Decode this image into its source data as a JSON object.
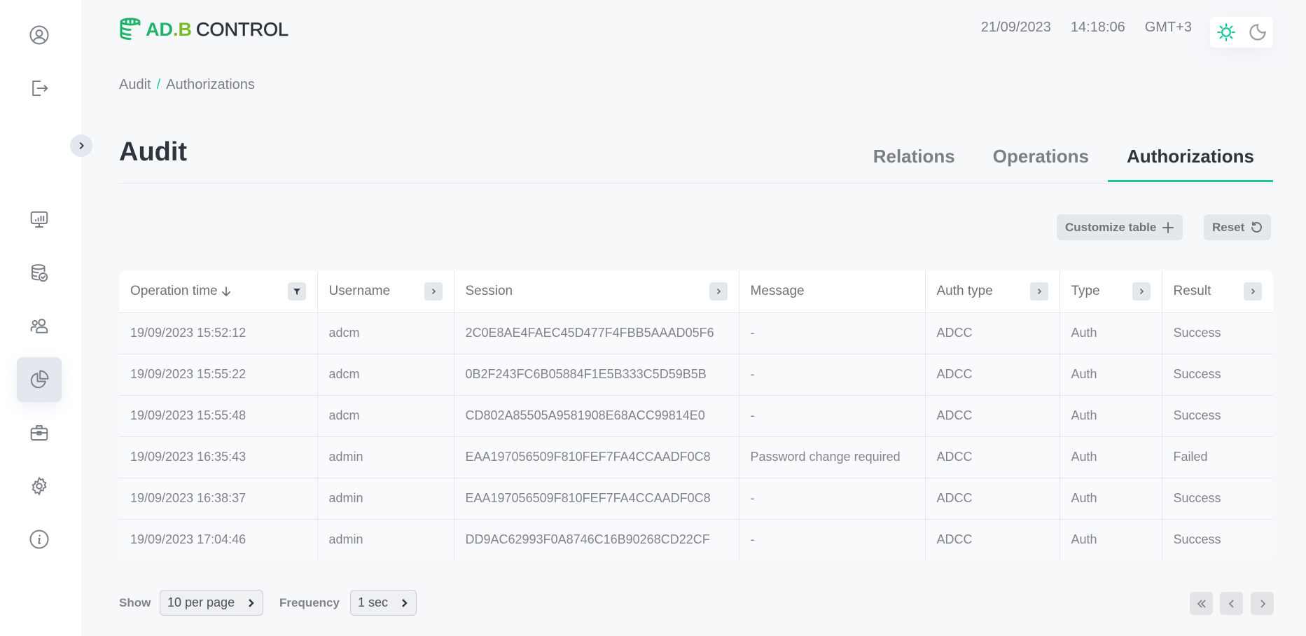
{
  "brand": {
    "name_part1": "AD",
    "name_dot": ".",
    "name_part2": "B",
    "name_part3": "CONTROL",
    "colors": {
      "primary_green": "#20b36b",
      "lime": "#7ab929",
      "accent": "#1ec89a",
      "dark": "#2c333c"
    }
  },
  "header": {
    "date": "21/09/2023",
    "time": "14:18:06",
    "timezone": "GMT+3",
    "theme_switch": {
      "light_icon": "sun-icon",
      "dark_icon": "moon-icon",
      "active": "light"
    }
  },
  "sidebar": {
    "top_items": [
      {
        "name": "profile",
        "icon": "user-circle-icon"
      },
      {
        "name": "logout",
        "icon": "logout-icon"
      }
    ],
    "collapse_icon": "chevron-right-icon",
    "items": [
      {
        "name": "monitoring",
        "icon": "monitor-chart-icon",
        "active": false
      },
      {
        "name": "backup",
        "icon": "database-check-icon",
        "active": false
      },
      {
        "name": "users",
        "icon": "users-icon",
        "active": false
      },
      {
        "name": "audit",
        "icon": "pie-chart-icon",
        "active": true
      },
      {
        "name": "jobs",
        "icon": "briefcase-icon",
        "active": false
      },
      {
        "name": "settings",
        "icon": "gear-icon",
        "active": false
      },
      {
        "name": "info",
        "icon": "info-icon",
        "active": false
      }
    ]
  },
  "breadcrumb": {
    "items": [
      "Audit",
      "Authorizations"
    ],
    "separator": "/"
  },
  "page": {
    "title": "Audit"
  },
  "tabs": [
    {
      "label": "Relations",
      "active": false
    },
    {
      "label": "Operations",
      "active": false
    },
    {
      "label": "Authorizations",
      "active": true
    }
  ],
  "toolbar": {
    "customize_label": "Customize table",
    "reset_label": "Reset"
  },
  "table": {
    "columns": [
      {
        "label": "Operation time",
        "sort": "desc",
        "action": "filter"
      },
      {
        "label": "Username",
        "action": "expand"
      },
      {
        "label": "Session",
        "action": "expand"
      },
      {
        "label": "Message",
        "action": "none"
      },
      {
        "label": "Auth type",
        "action": "expand"
      },
      {
        "label": "Type",
        "action": "expand"
      },
      {
        "label": "Result",
        "action": "expand"
      }
    ],
    "rows": [
      [
        "19/09/2023 15:52:12",
        "adcm",
        "2C0E8AE4FAEC45D477F4FBB5AAAD05F6",
        "-",
        "ADCC",
        "Auth",
        "Success"
      ],
      [
        "19/09/2023 15:55:22",
        "adcm",
        "0B2F243FC6B05884F1E5B333C5D59B5B",
        "-",
        "ADCC",
        "Auth",
        "Success"
      ],
      [
        "19/09/2023 15:55:48",
        "adcm",
        "CD802A85505A9581908E68ACC99814E0",
        "-",
        "ADCC",
        "Auth",
        "Success"
      ],
      [
        "19/09/2023 16:35:43",
        "admin",
        "EAA197056509F810FEF7FA4CCAADF0C8",
        "Password change required",
        "ADCC",
        "Auth",
        "Failed"
      ],
      [
        "19/09/2023 16:38:37",
        "admin",
        "EAA197056509F810FEF7FA4CCAADF0C8",
        "-",
        "ADCC",
        "Auth",
        "Success"
      ],
      [
        "19/09/2023 17:04:46",
        "admin",
        "DD9AC62993F0A8746C16B90268CD22CF",
        "-",
        "ADCC",
        "Auth",
        "Success"
      ]
    ]
  },
  "footer": {
    "show_label": "Show",
    "per_page_value": "10 per page",
    "frequency_label": "Frequency",
    "frequency_value": "1 sec",
    "pagination": {
      "first_icon": "double-chevron-left-icon",
      "prev_icon": "chevron-left-icon",
      "next_icon": "chevron-right-icon"
    }
  }
}
